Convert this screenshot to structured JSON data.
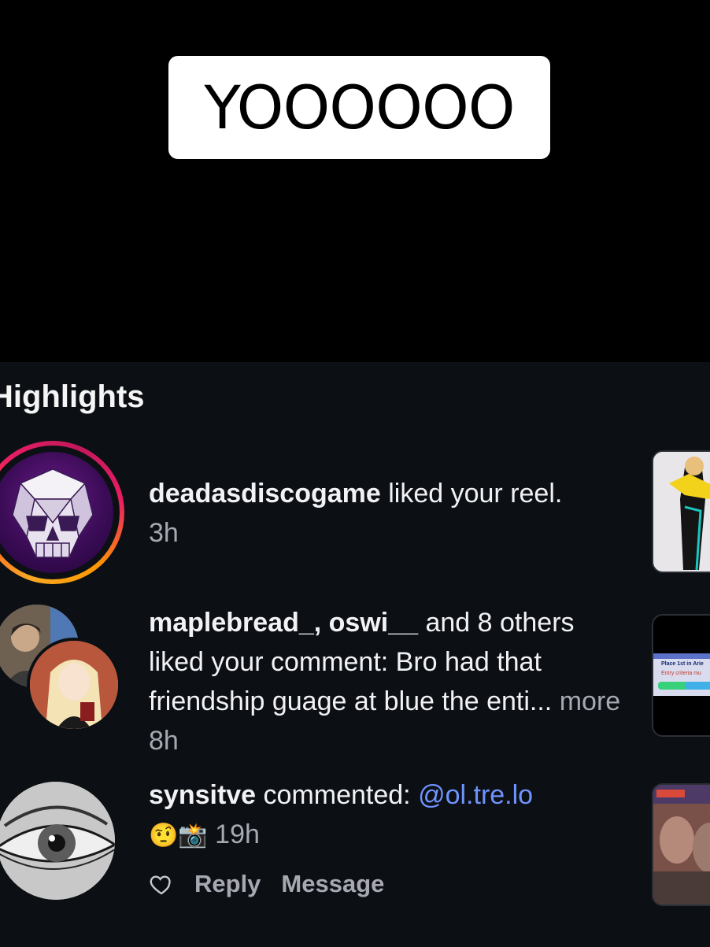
{
  "caption": "YOOOOOO",
  "section_title": "Highlights",
  "notifications": [
    {
      "user": "deadasdiscogame",
      "text": " liked your reel.",
      "time": "3h"
    },
    {
      "users": "maplebread_, oswi__",
      "text": " and 8 others liked your comment: Bro had that friendship guage at blue the enti...",
      "more": " more",
      "time": " 8h",
      "thumb_text_1": "Place 1st in Arie",
      "thumb_text_2": "Entry criteria mu"
    },
    {
      "user": "synsitve",
      "text": " commented: ",
      "mention": "@ol.tre.lo",
      "emojis": "🤨📸",
      "time": " 19h",
      "reply_label": "Reply",
      "message_label": "Message"
    }
  ],
  "colors": {
    "panel_bg": "#0c1014",
    "mention": "#6f93ff",
    "muted": "#a8a8b3"
  }
}
